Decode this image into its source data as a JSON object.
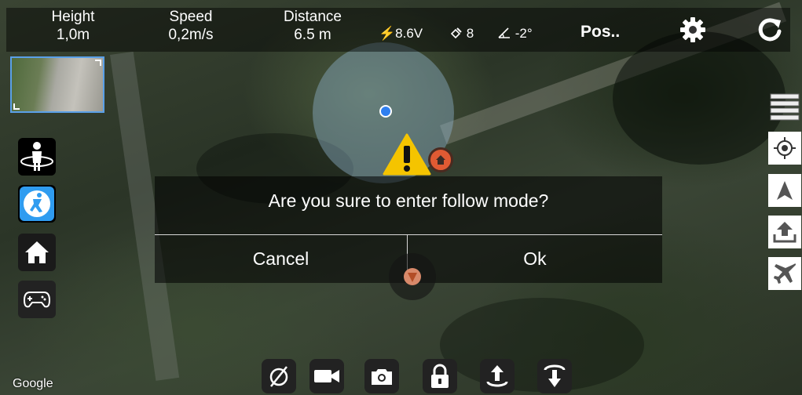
{
  "telemetry": {
    "height_label": "Height",
    "height_value": "1,0m",
    "speed_label": "Speed",
    "speed_value": "0,2m/s",
    "distance_label": "Distance",
    "distance_value": "6.5 m",
    "battery_voltage": "8.6V",
    "satellites": "8",
    "tilt": "-2°",
    "mode": "Pos.."
  },
  "dialog": {
    "message": "Are you sure to enter follow mode?",
    "cancel_label": "Cancel",
    "ok_label": "Ok"
  },
  "left_toolbar": [
    "orbit-mode-icon",
    "follow-me-icon",
    "home-icon",
    "gamepad-icon"
  ],
  "right_toolbar": [
    "layers-icon",
    "locate-icon",
    "navigation-arrow-icon",
    "upload-icon",
    "airplane-icon"
  ],
  "bottom_toolbar": [
    "no-signal-icon",
    "video-camera-icon",
    "camera-icon",
    "lock-icon",
    "takeoff-icon",
    "landing-icon"
  ],
  "map_attribution": "Google",
  "colors": {
    "accent_blue": "#2f9cf0",
    "warning_yellow": "#f5c400",
    "home_marker": "#e05a33",
    "overlay_bar": "rgba(0,0,0,0.45)"
  }
}
